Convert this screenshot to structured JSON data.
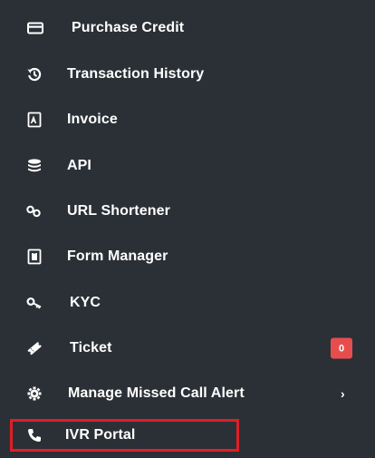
{
  "menu": {
    "items": [
      {
        "label": "Purchase Credit",
        "icon": "credit-card-icon"
      },
      {
        "label": "Transaction History",
        "icon": "history-icon"
      },
      {
        "label": "Invoice",
        "icon": "pdf-file-icon"
      },
      {
        "label": "API",
        "icon": "database-icon"
      },
      {
        "label": "URL Shortener",
        "icon": "link-icon"
      },
      {
        "label": "Form Manager",
        "icon": "form-icon"
      },
      {
        "label": "KYC",
        "icon": "key-icon"
      },
      {
        "label": "Ticket",
        "icon": "ticket-icon",
        "badge": "0"
      },
      {
        "label": "Manage Missed Call Alert",
        "icon": "gear-icon",
        "chevron": "›"
      },
      {
        "label": "IVR Portal",
        "icon": "phone-icon",
        "highlighted": true
      }
    ]
  },
  "colors": {
    "background": "#2b3036",
    "text": "#ffffff",
    "badge": "#e84d4d",
    "highlight_border": "#e01e26"
  }
}
